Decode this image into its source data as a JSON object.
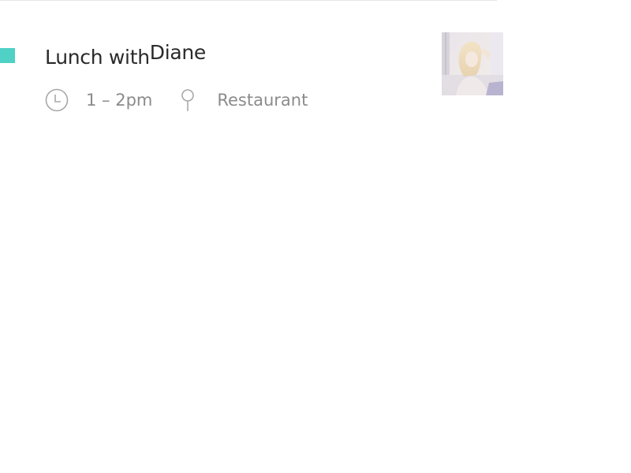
{
  "event": {
    "title_prefix": "Lunch with",
    "title_name": "Diane",
    "time": "1 – 2pm",
    "location": "Restaurant",
    "accent_color": "#4fd1c5",
    "icons": {
      "time": "clock-icon",
      "location": "map-pin-icon"
    },
    "avatar_icon": "contact-photo"
  }
}
